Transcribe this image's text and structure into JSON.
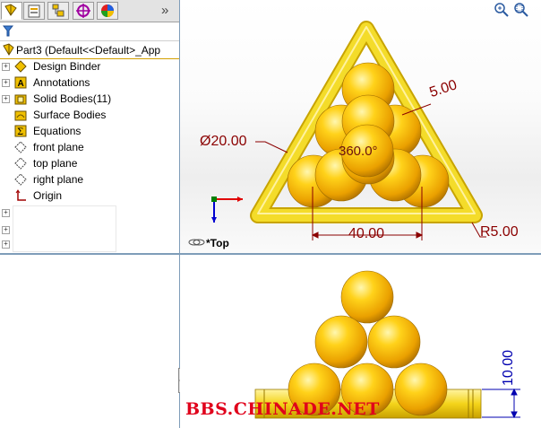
{
  "tabs": [
    "feature-manager-tab",
    "property-manager-tab",
    "configuration-manager-tab",
    "dimxpert-manager-tab",
    "display-manager-tab"
  ],
  "expand_tabs_glyph": "»",
  "tree": {
    "root": "Part3  (Default<<Default>_App",
    "items": [
      {
        "label": "Design Binder",
        "icon": "design-binder-icon",
        "expandable": true
      },
      {
        "label": "Annotations",
        "icon": "annotations-icon",
        "expandable": true
      },
      {
        "label": "Solid Bodies(11)",
        "icon": "solid-bodies-icon",
        "expandable": true
      },
      {
        "label": "Surface Bodies",
        "icon": "surface-bodies-icon",
        "expandable": false
      },
      {
        "label": "Equations",
        "icon": "equations-icon",
        "expandable": false
      },
      {
        "label": "front plane",
        "icon": "plane-icon",
        "expandable": false
      },
      {
        "label": "top plane",
        "icon": "plane-icon",
        "expandable": false
      },
      {
        "label": "right plane",
        "icon": "plane-icon",
        "expandable": false
      },
      {
        "label": "Origin",
        "icon": "origin-icon",
        "expandable": false
      }
    ]
  },
  "top_view": {
    "view_label": "*Top",
    "dim_diameter": "Ø20.00",
    "dim_width": "5.00",
    "dim_angle": "360.0°",
    "dim_length": "40.00",
    "dim_radius": "R5.00"
  },
  "front_view": {
    "dim_height": "10.00"
  },
  "watermark": "BBS.CHINADE.NET",
  "colors": {
    "ball": "#f5b800",
    "frame": "#f2d21c",
    "dimension": "#8b0000",
    "split": "#7f9db9"
  }
}
